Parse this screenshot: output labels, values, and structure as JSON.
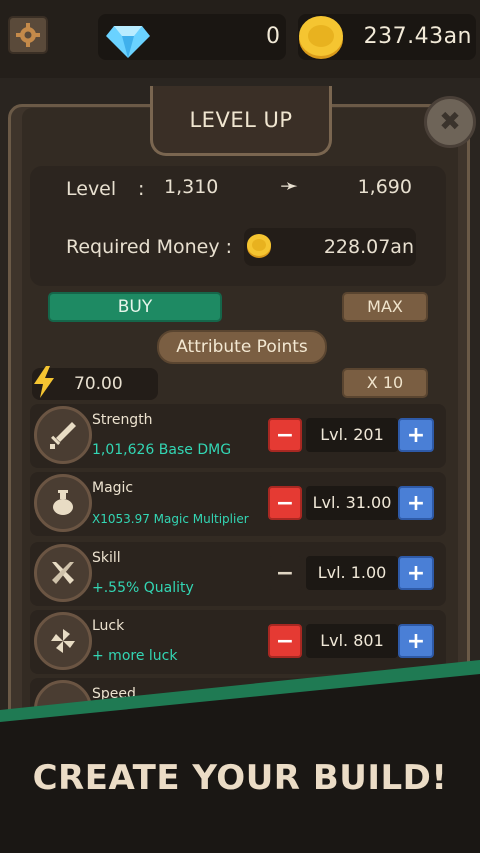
{
  "hud": {
    "gems": "0",
    "coins": "237.43an"
  },
  "panel": {
    "title": "LEVEL UP",
    "close_label": "✖",
    "level_label": "Level",
    "level_colon": ":",
    "level_from": "1,310",
    "level_arrow": "➛",
    "level_to": "1,690",
    "required_label": "Required Money :",
    "required_value": "228.07an",
    "buy_label": "BUY",
    "max_label": "MAX",
    "attr_title": "Attribute Points",
    "points": "70.00",
    "multiplier_label": "X 10"
  },
  "attributes": [
    {
      "name": "Strength",
      "desc": "1,01,626 Base DMG",
      "level": "Lvl. 201",
      "icon": "sword-icon"
    },
    {
      "name": "Magic",
      "desc": "X1053.97 Magic Multiplier",
      "level": "Lvl. 31.00",
      "icon": "potion-icon"
    },
    {
      "name": "Skill",
      "desc": "+.55% Quality",
      "level": "Lvl. 1.00",
      "icon": "crossed-swords-icon"
    },
    {
      "name": "Luck",
      "desc": "+ more luck",
      "level": "Lvl. 801",
      "icon": "clover-icon"
    },
    {
      "name": "Speed",
      "desc": "",
      "level": "",
      "icon": "speed-icon"
    }
  ],
  "banner": {
    "text": "CREATE YOUR BUILD!"
  },
  "colors": {
    "accent_green": "#1e8a63",
    "minus_red": "#e53a33",
    "plus_blue": "#4a7fd6",
    "teal_text": "#33d6b4"
  }
}
